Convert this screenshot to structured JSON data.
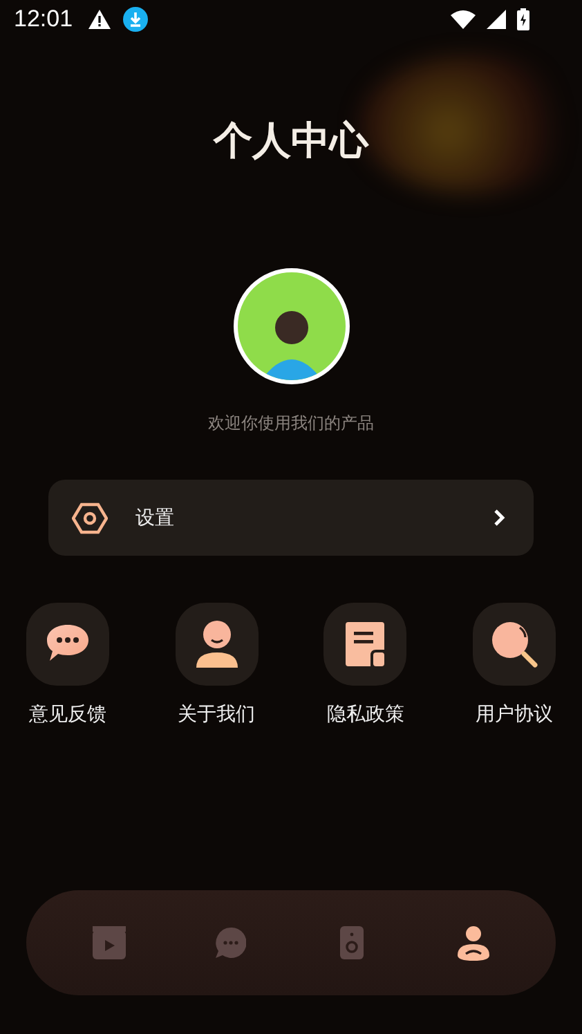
{
  "status_bar": {
    "time": "12:01"
  },
  "title": "个人中心",
  "welcome": "欢迎你使用我们的产品",
  "settings": {
    "label": "设置"
  },
  "shortcuts": [
    {
      "kind": "feedback",
      "label": "意见反馈"
    },
    {
      "kind": "about",
      "label": "关于我们"
    },
    {
      "kind": "privacy",
      "label": "隐私政策"
    },
    {
      "kind": "agreement",
      "label": "用户协议"
    }
  ],
  "nav": [
    {
      "kind": "video",
      "selected": false
    },
    {
      "kind": "chat",
      "selected": false
    },
    {
      "kind": "speaker",
      "selected": false
    },
    {
      "kind": "profile",
      "selected": true
    }
  ]
}
